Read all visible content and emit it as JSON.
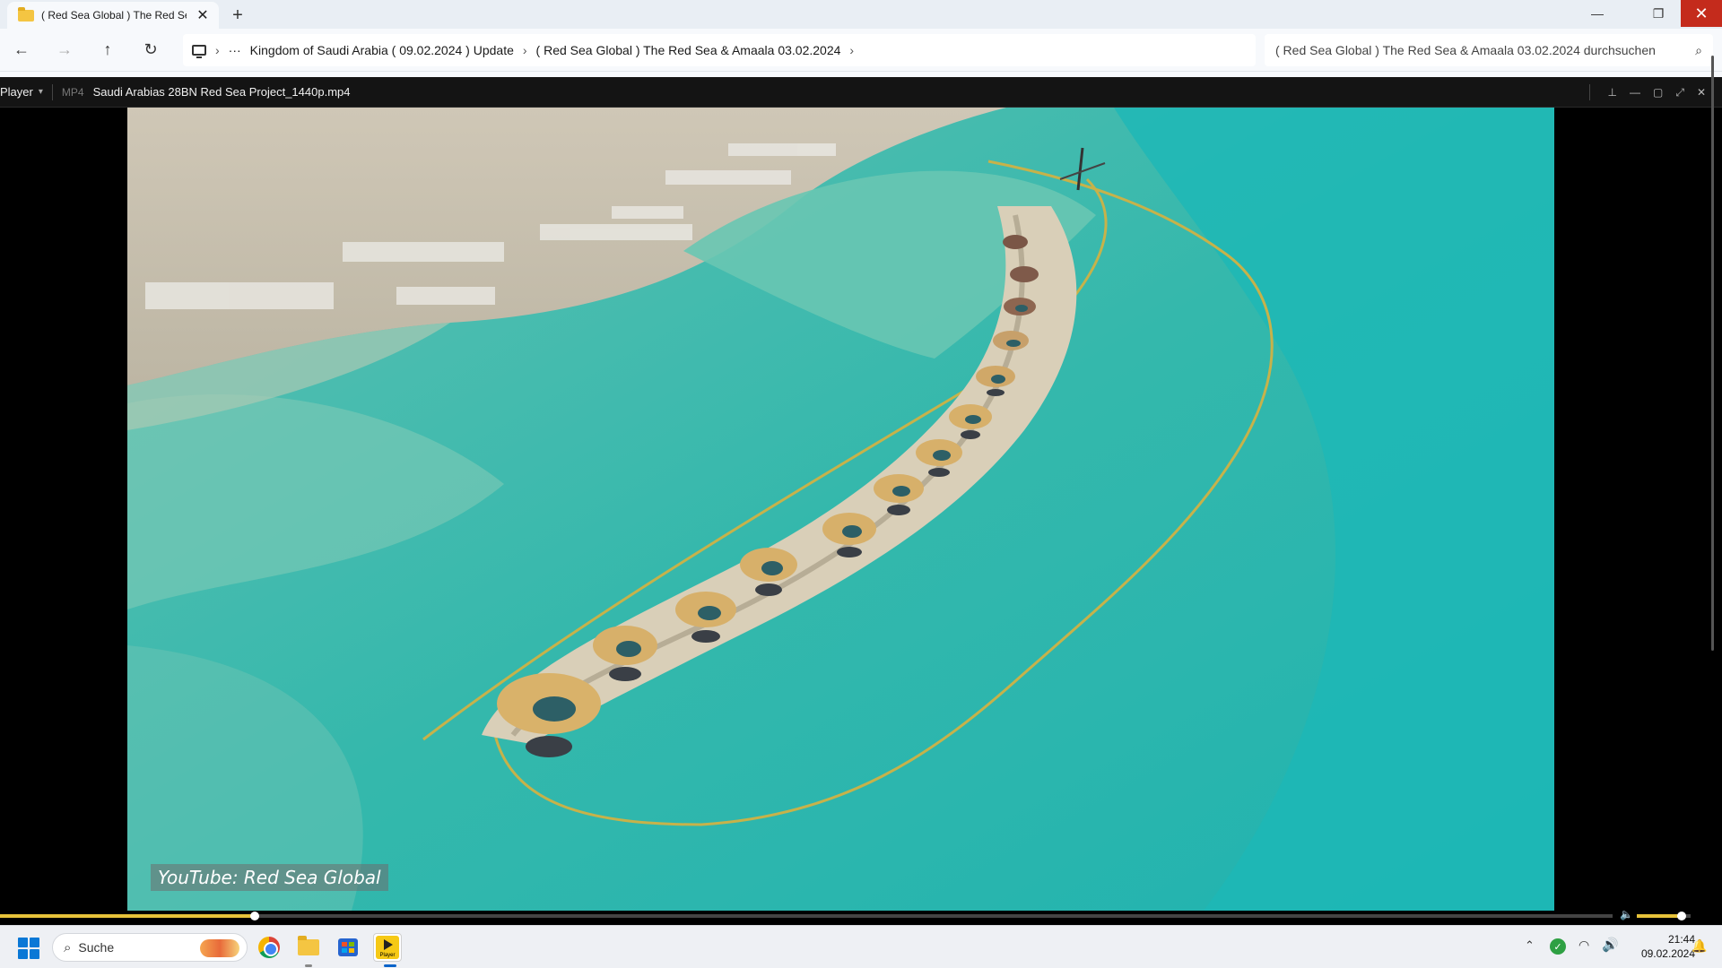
{
  "explorer": {
    "tab_title": "( Red Sea Global ) The Red Sea",
    "breadcrumbs": [
      "Kingdom of Saudi Arabia ( 09.02.2024 ) Update",
      "( Red Sea Global ) The Red Sea & Amaala 03.02.2024"
    ],
    "search_placeholder": "( Red Sea Global ) The Red Sea & Amaala 03.02.2024 durchsuchen",
    "icons": {
      "tab": "folder-icon",
      "back": "arrow-left-icon",
      "forward": "arrow-right-icon",
      "up": "arrow-up-icon",
      "refresh": "refresh-icon",
      "pc": "monitor-icon",
      "more": "ellipsis-icon",
      "search": "search-icon"
    }
  },
  "player": {
    "menu_label": "Player",
    "format": "MP4",
    "file_title": "Saudi Arabias 28BN Red Sea Project_1440p.mp4",
    "watermark": "YouTube: Red Sea Global",
    "progress_fraction": 0.158,
    "volume_fraction": 0.83,
    "accent_color": "#e6c23a"
  },
  "taskbar": {
    "search_label": "Suche",
    "time": "21:44",
    "date": "09.02.2024",
    "apps": [
      "chrome-icon",
      "file-explorer-icon",
      "microsoft-store-icon",
      "player-icon"
    ]
  }
}
